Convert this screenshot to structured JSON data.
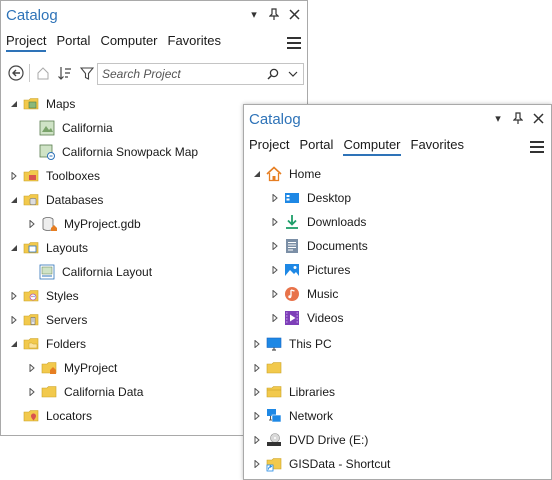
{
  "left_pane": {
    "title": "Catalog",
    "tabs": [
      {
        "label": "Project",
        "active": true
      },
      {
        "label": "Portal",
        "active": false
      },
      {
        "label": "Computer",
        "active": false
      },
      {
        "label": "Favorites",
        "active": false
      }
    ],
    "search": {
      "placeholder": "Search Project"
    },
    "tree": [
      {
        "label": "Maps",
        "icon": "maps-folder-icon",
        "expanded": true
      },
      {
        "label": "California",
        "icon": "map-icon"
      },
      {
        "label": "California Snowpack Map",
        "icon": "map-linked-icon"
      },
      {
        "label": "Toolboxes",
        "icon": "toolbox-folder-icon",
        "expanded": false
      },
      {
        "label": "Databases",
        "icon": "database-folder-icon",
        "expanded": true
      },
      {
        "label": "MyProject.gdb",
        "icon": "geodatabase-home-icon",
        "expanded": false
      },
      {
        "label": "Layouts",
        "icon": "layouts-folder-icon",
        "expanded": true
      },
      {
        "label": "California Layout",
        "icon": "layout-icon"
      },
      {
        "label": "Styles",
        "icon": "styles-folder-icon",
        "expanded": false
      },
      {
        "label": "Servers",
        "icon": "servers-folder-icon",
        "expanded": false
      },
      {
        "label": "Folders",
        "icon": "folders-folder-icon",
        "expanded": true
      },
      {
        "label": "MyProject",
        "icon": "home-folder-icon",
        "expanded": false
      },
      {
        "label": "California Data",
        "icon": "folder-icon",
        "expanded": false
      },
      {
        "label": "Locators",
        "icon": "locators-folder-icon"
      }
    ]
  },
  "right_pane": {
    "title": "Catalog",
    "tabs": [
      {
        "label": "Project",
        "active": false
      },
      {
        "label": "Portal",
        "active": false
      },
      {
        "label": "Computer",
        "active": true
      },
      {
        "label": "Favorites",
        "active": false
      }
    ],
    "tree": [
      {
        "label": "Home",
        "icon": "home-icon",
        "expanded": true
      },
      {
        "label": "Desktop",
        "icon": "desktop-icon",
        "expanded": false
      },
      {
        "label": "Downloads",
        "icon": "downloads-icon",
        "expanded": false
      },
      {
        "label": "Documents",
        "icon": "documents-icon",
        "expanded": false
      },
      {
        "label": "Pictures",
        "icon": "pictures-icon",
        "expanded": false
      },
      {
        "label": "Music",
        "icon": "music-icon",
        "expanded": false
      },
      {
        "label": "Videos",
        "icon": "videos-icon",
        "expanded": false
      },
      {
        "label": "This PC",
        "icon": "monitor-icon",
        "expanded": false
      },
      {
        "label": "",
        "icon": "folder-icon",
        "expanded": false
      },
      {
        "label": "Libraries",
        "icon": "libraries-icon",
        "expanded": false
      },
      {
        "label": "Network",
        "icon": "network-icon",
        "expanded": false
      },
      {
        "label": "DVD Drive (E:)",
        "icon": "dvd-drive-icon",
        "expanded": false
      },
      {
        "label": "GISData - Shortcut",
        "icon": "folder-shortcut-icon",
        "expanded": false
      }
    ]
  },
  "colors": {
    "accent": "#2e73b8",
    "folder": "#f2c94c",
    "border": "#a9a9a9"
  }
}
